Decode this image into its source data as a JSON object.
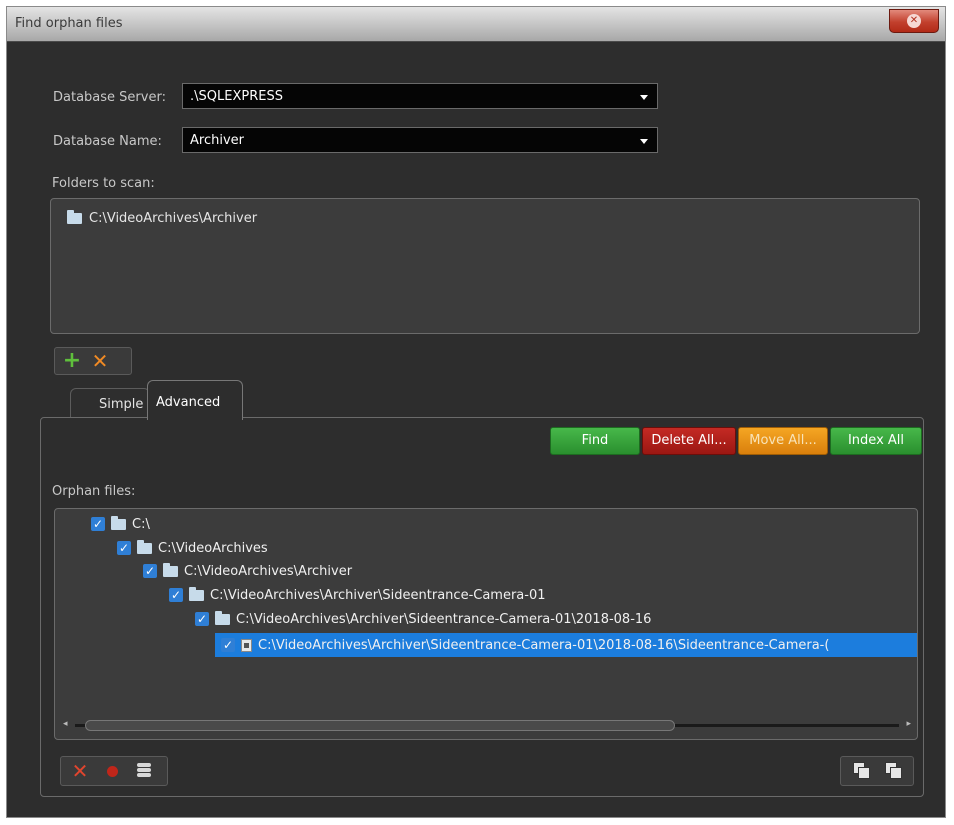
{
  "window": {
    "title": "Find orphan files"
  },
  "db_server": {
    "label": "Database Server:",
    "value": ".\\SQLEXPRESS"
  },
  "db_name": {
    "label": "Database Name:",
    "value": "Archiver"
  },
  "folders": {
    "label": "Folders to scan:",
    "items": [
      "C:\\VideoArchives\\Archiver"
    ]
  },
  "tabs": {
    "simple": "Simple",
    "advanced": "Advanced",
    "selected": "Advanced"
  },
  "actions": {
    "find": "Find",
    "delete_all": "Delete All...",
    "move_all": "Move All...",
    "index_all": "Index All"
  },
  "orphan": {
    "label": "Orphan files:",
    "tree": [
      {
        "text": "C:\\",
        "type": "folder",
        "checked": true
      },
      {
        "text": "C:\\VideoArchives",
        "type": "folder",
        "checked": true
      },
      {
        "text": "C:\\VideoArchives\\Archiver",
        "type": "folder",
        "checked": true
      },
      {
        "text": "C:\\VideoArchives\\Archiver\\Sideentrance-Camera-01",
        "type": "folder",
        "checked": true
      },
      {
        "text": "C:\\VideoArchives\\Archiver\\Sideentrance-Camera-01\\2018-08-16",
        "type": "folder",
        "checked": true
      },
      {
        "text": "C:\\VideoArchives\\Archiver\\Sideentrance-Camera-01\\2018-08-16\\Sideentrance-Camera-(",
        "type": "file",
        "checked": true,
        "selected": true
      }
    ]
  },
  "colors": {
    "find": "#2f9a33",
    "delete": "#a81c16",
    "move": "#e8920f",
    "index": "#2f9a33",
    "selection": "#1c7ddd"
  }
}
